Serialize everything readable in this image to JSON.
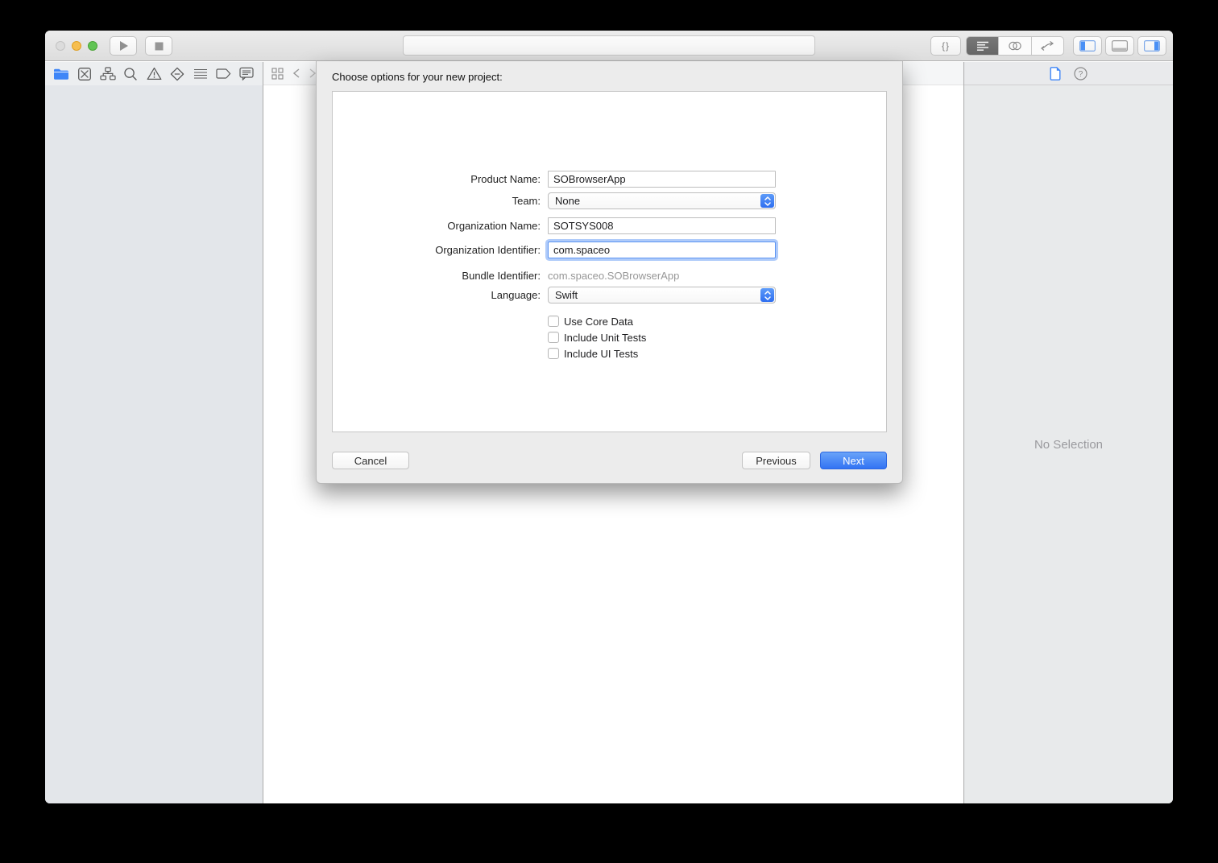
{
  "toolbar": {
    "snippet_label": "{}",
    "icons": [
      "close-traffic-light",
      "minimize-traffic-light",
      "zoom-traffic-light",
      "run-icon",
      "stop-icon",
      "standard-editor-icon",
      "assistant-editor-icon",
      "version-editor-icon",
      "navigator-panel-toggle-icon",
      "debug-panel-toggle-icon",
      "inspector-panel-toggle-icon"
    ]
  },
  "navigator_bar": {
    "icons": [
      "project-navigator-icon",
      "source-control-navigator-icon",
      "symbol-navigator-icon",
      "find-navigator-icon",
      "issue-navigator-icon",
      "test-navigator-icon",
      "debug-navigator-icon",
      "breakpoint-navigator-icon",
      "report-navigator-icon"
    ]
  },
  "jumpbar": {
    "icons": [
      "related-items-icon",
      "back-chevron-icon",
      "forward-chevron-icon"
    ]
  },
  "inspector": {
    "icons": [
      "file-inspector-icon",
      "quick-help-icon"
    ],
    "no_selection": "No Selection"
  },
  "dialog": {
    "title": "Choose options for your new project:",
    "fields": [
      {
        "label": "Product Name:",
        "value": "SOBrowserApp",
        "type": "text"
      },
      {
        "label": "Team:",
        "value": "None",
        "type": "popup"
      },
      {
        "label": "Organization Name:",
        "value": "SOTSYS008",
        "type": "text"
      },
      {
        "label": "Organization Identifier:",
        "value": "com.spaceo",
        "type": "text",
        "focused": true
      },
      {
        "label": "Bundle Identifier:",
        "value": "com.spaceo.SOBrowserApp",
        "type": "static"
      },
      {
        "label": "Language:",
        "value": "Swift",
        "type": "popup"
      }
    ],
    "checkboxes": [
      {
        "label": "Use Core Data",
        "checked": false
      },
      {
        "label": "Include Unit Tests",
        "checked": false
      },
      {
        "label": "Include UI Tests",
        "checked": false
      }
    ],
    "buttons": {
      "cancel": "Cancel",
      "previous": "Previous",
      "next": "Next"
    }
  },
  "colors": {
    "accent_blue": "#3f86f7",
    "next_button_top": "#69a3f9",
    "next_button_bottom": "#3273f3",
    "focus_ring": "#6ea0f5",
    "sheet_bg": "#ececec",
    "sidebar_bg": "#e3e6ea",
    "inspector_bg": "#e8eaeb",
    "minimize_yellow": "#f6be4f",
    "zoom_green": "#61c454"
  }
}
